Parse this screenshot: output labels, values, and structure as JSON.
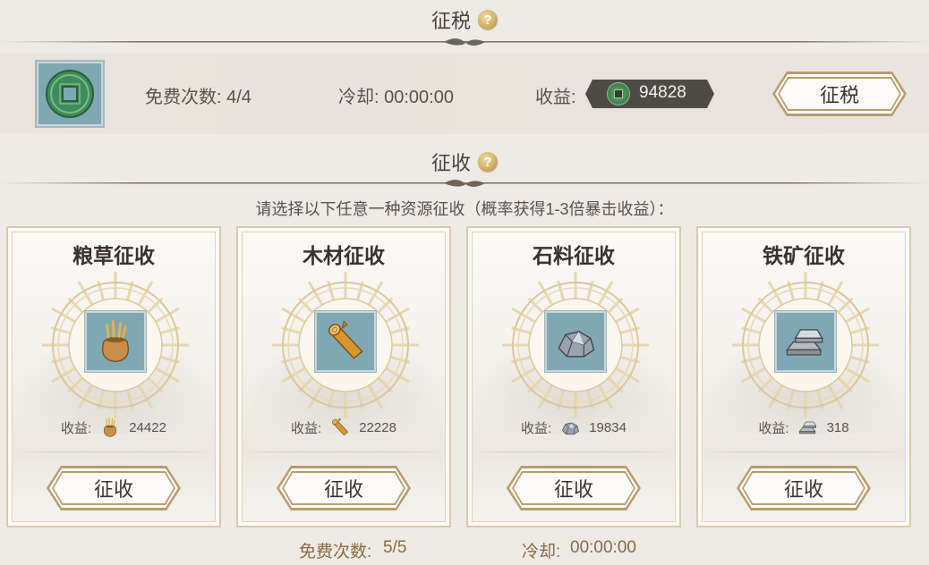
{
  "tax_section": {
    "title": "征税",
    "free_count_label": "免费次数: 4/4",
    "cooldown_label": "冷却: 00:00:00",
    "income_label": "收益:",
    "income_value": "94828",
    "button_label": "征税"
  },
  "collect_section": {
    "title": "征收",
    "instruction": "请选择以下任意一种资源征收（概率获得1-3倍暴击收益）：",
    "cards": [
      {
        "title": "粮草征收",
        "income_label": "收益:",
        "income_value": "24422",
        "button_label": "征收",
        "icon": "grain-sack-icon"
      },
      {
        "title": "木材征收",
        "income_label": "收益:",
        "income_value": "22228",
        "button_label": "征收",
        "icon": "wood-log-icon"
      },
      {
        "title": "石料征收",
        "income_label": "收益:",
        "income_value": "19834",
        "button_label": "征收",
        "icon": "stone-icon"
      },
      {
        "title": "铁矿征收",
        "income_label": "收益:",
        "income_value": "318",
        "button_label": "征收",
        "icon": "iron-ingot-icon"
      }
    ],
    "footer": {
      "free_count_label": "免费次数:",
      "free_count_value": "5/5",
      "cooldown_label": "冷却:",
      "cooldown_value": "00:00:00"
    }
  },
  "colors": {
    "background": "#eeebe6",
    "accent_gold": "#b99b6b",
    "icon_bg": "#7fa8b4",
    "footer_text": "#8a6a3e"
  }
}
